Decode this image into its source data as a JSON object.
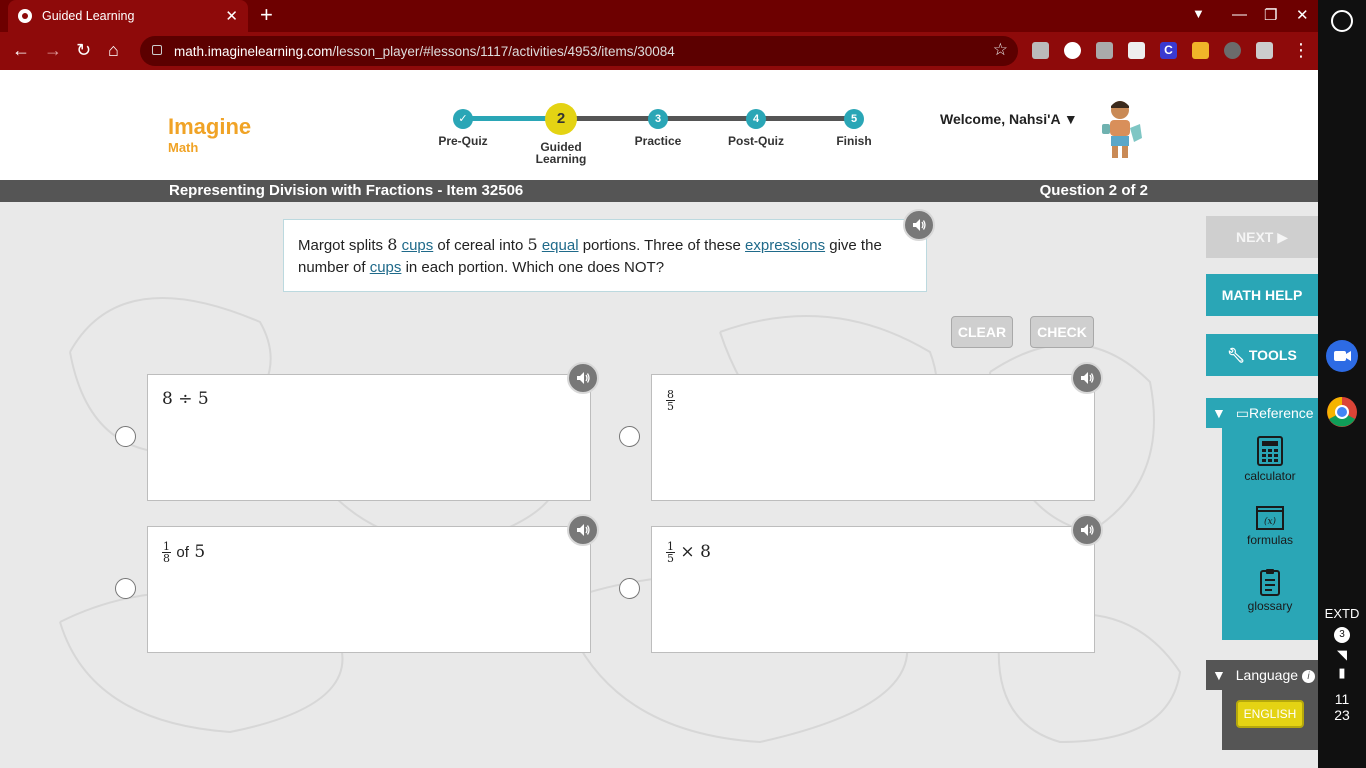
{
  "browser": {
    "tab_title": "Guided Learning",
    "url_host": "math.imaginelearning.com",
    "url_path": "/lesson_player/#lessons/1117/activities/4953/items/30084"
  },
  "header": {
    "brand": "Imagine",
    "brand_sub": "Math",
    "welcome": "Welcome, Nahsi'A ▼",
    "steps": [
      {
        "number": "✓",
        "label": "Pre-Quiz"
      },
      {
        "number": "2",
        "label": "Guided Learning"
      },
      {
        "number": "3",
        "label": "Practice"
      },
      {
        "number": "4",
        "label": "Post-Quiz"
      },
      {
        "number": "5",
        "label": "Finish"
      }
    ]
  },
  "titlebar": {
    "lesson": "Representing Division with Fractions - Item 32506",
    "question": "Question 2 of 2"
  },
  "prompt": {
    "t1": "Margot splits ",
    "n1": "8",
    "l1": "cups",
    "t2": " of cereal into ",
    "n2": "5",
    "l2": "equal",
    "t3": " portions. Three of these ",
    "l3": "expressions",
    "t4": " give the number of ",
    "l4": "cups",
    "t5": " in each portion. Which one does NOT?"
  },
  "actions": {
    "clear": "CLEAR",
    "check": "CHECK"
  },
  "choices": {
    "a": {
      "left": "8",
      "op": "÷",
      "right": "5"
    },
    "b": {
      "num": "8",
      "den": "5"
    },
    "c": {
      "num": "1",
      "den": "8",
      "word": "of",
      "value": "5"
    },
    "d": {
      "num": "1",
      "den": "5",
      "op": "×",
      "value": "8"
    }
  },
  "sidebar": {
    "next": "NEXT ▶",
    "math_help": "MATH HELP",
    "tools": "TOOLS",
    "reference": "Reference",
    "ref_items": [
      "calculator",
      "formulas",
      "glossary"
    ],
    "language": "Language",
    "english": "ENGLISH"
  },
  "shelf": {
    "extd": "EXTD",
    "badge": "3",
    "time_h": "11",
    "time_m": "23"
  },
  "colors": {
    "accent": "#2aa6b6",
    "brand": "#f0a326",
    "current_step": "#e4d313",
    "browser": "#8e0a0a"
  }
}
